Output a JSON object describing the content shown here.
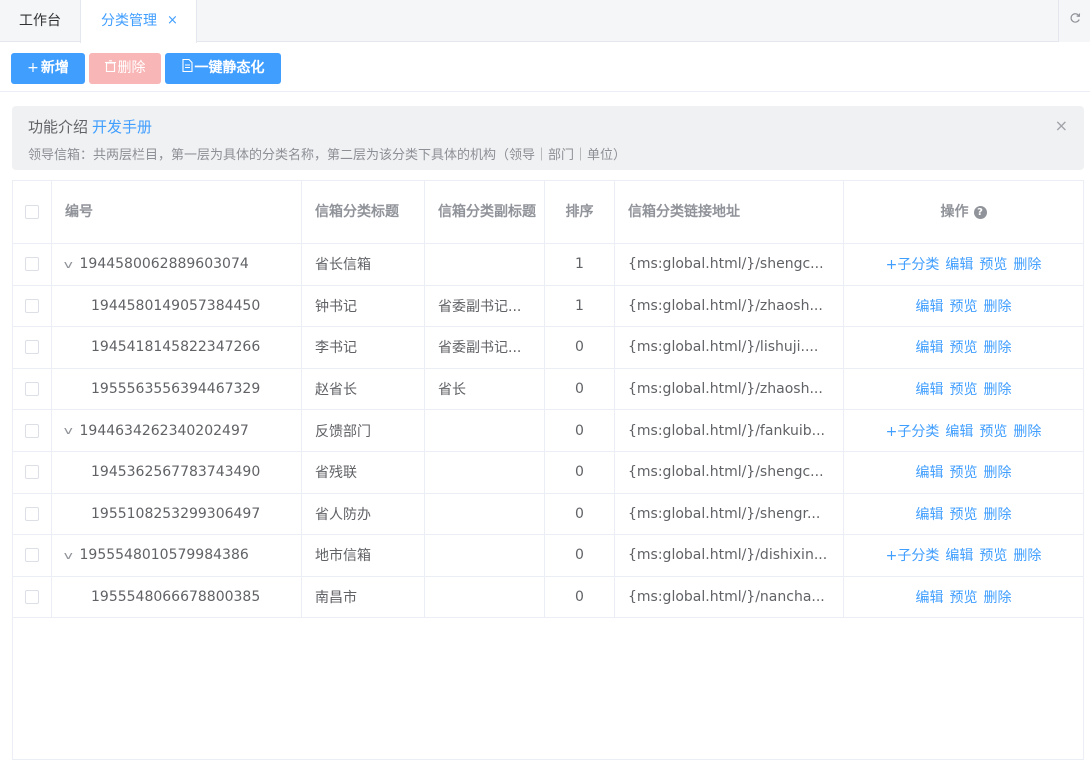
{
  "tabs": [
    {
      "label": "工作台"
    },
    {
      "label": "分类管理",
      "close": "×"
    }
  ],
  "toolbar": {
    "add_icon": "+",
    "add_label": "新增",
    "delete_label": "删除",
    "static_label": "一键静态化"
  },
  "alert": {
    "title": "功能介绍",
    "link": "开发手册",
    "desc": "领导信箱：共两层栏目，第一层为具体的分类名称，第二层为该分类下具体的机构（领导｜部门｜单位）",
    "close": "×"
  },
  "table": {
    "headers": {
      "id": "编号",
      "title": "信箱分类标题",
      "subtitle": "信箱分类副标题",
      "sort": "排序",
      "url": "信箱分类链接地址",
      "ops": "操作"
    },
    "rows": [
      {
        "id": "1944580062889603074",
        "title": "省长信箱",
        "subtitle": "",
        "sort": "1",
        "url": "{ms:global.html/}/shengc...",
        "level": 0,
        "ops": [
          "+子分类",
          "编辑",
          "预览",
          "删除"
        ]
      },
      {
        "id": "1944580149057384450",
        "title": "钟书记",
        "subtitle": "省委副书记...",
        "sort": "1",
        "url": "{ms:global.html/}/zhaosh...",
        "level": 1,
        "ops": [
          "编辑",
          "预览",
          "删除"
        ]
      },
      {
        "id": "1945418145822347266",
        "title": "李书记",
        "subtitle": "省委副书记...",
        "sort": "0",
        "url": "{ms:global.html/}/lishuji....",
        "level": 1,
        "ops": [
          "编辑",
          "预览",
          "删除"
        ]
      },
      {
        "id": "1955563556394467329",
        "title": "赵省长",
        "subtitle": "省长",
        "sort": "0",
        "url": "{ms:global.html/}/zhaosh...",
        "level": 1,
        "ops": [
          "编辑",
          "预览",
          "删除"
        ]
      },
      {
        "id": "1944634262340202497",
        "title": "反馈部门",
        "subtitle": "",
        "sort": "0",
        "url": "{ms:global.html/}/fankuib...",
        "level": 0,
        "ops": [
          "+子分类",
          "编辑",
          "预览",
          "删除"
        ]
      },
      {
        "id": "1945362567783743490",
        "title": "省残联",
        "subtitle": "",
        "sort": "0",
        "url": "{ms:global.html/}/shengc...",
        "level": 1,
        "ops": [
          "编辑",
          "预览",
          "删除"
        ]
      },
      {
        "id": "1955108253299306497",
        "title": "省人防办",
        "subtitle": "",
        "sort": "0",
        "url": "{ms:global.html/}/shengr...",
        "level": 1,
        "ops": [
          "编辑",
          "预览",
          "删除"
        ]
      },
      {
        "id": "1955548010579984386",
        "title": "地市信箱",
        "subtitle": "",
        "sort": "0",
        "url": "{ms:global.html/}/dishixin...",
        "level": 0,
        "ops": [
          "+子分类",
          "编辑",
          "预览",
          "删除"
        ]
      },
      {
        "id": "1955548066678800385",
        "title": "南昌市",
        "subtitle": "",
        "sort": "0",
        "url": "{ms:global.html/}/nancha...",
        "level": 1,
        "ops": [
          "编辑",
          "预览",
          "删除"
        ]
      }
    ]
  },
  "colors": {
    "primary": "#409eff",
    "danger_disabled": "#f9b6b6"
  }
}
